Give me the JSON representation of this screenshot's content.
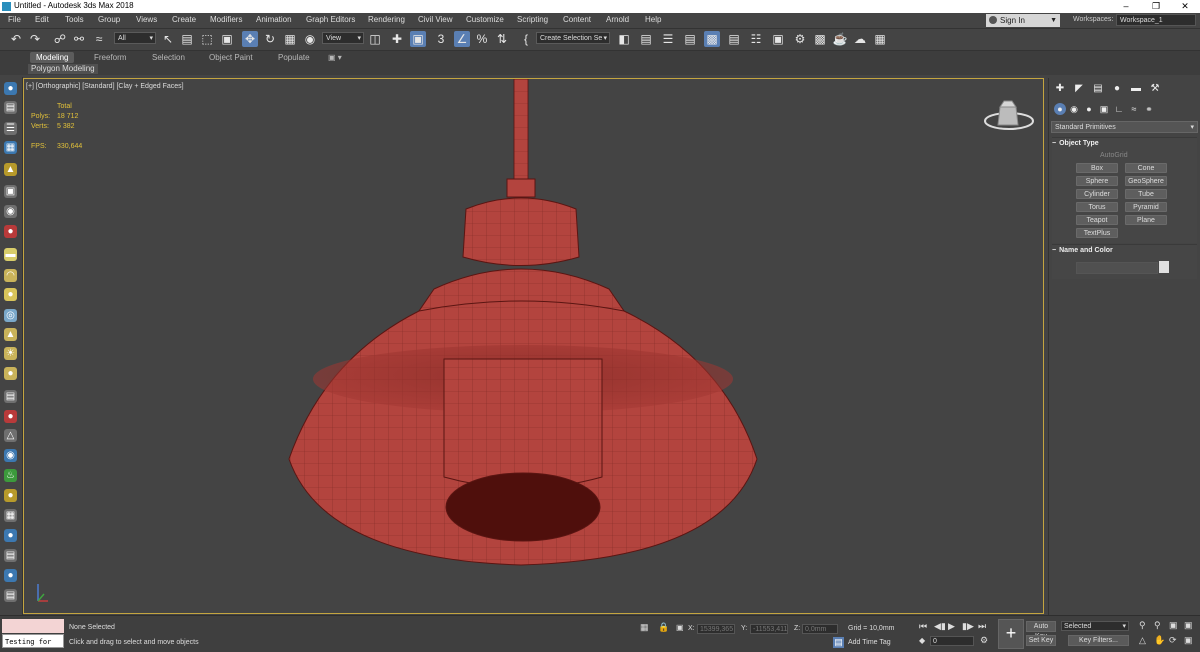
{
  "window": {
    "title": "Untitled - Autodesk 3ds Max 2018"
  },
  "menu": [
    "File",
    "Edit",
    "Tools",
    "Group",
    "Views",
    "Create",
    "Modifiers",
    "Animation",
    "Graph Editors",
    "Rendering",
    "Civil View",
    "Customize",
    "Scripting",
    "Content",
    "Arnold",
    "Help"
  ],
  "account": {
    "sign_in": "Sign In",
    "workspaces_label": "Workspaces:",
    "workspace": "Workspace_1"
  },
  "toolbar": {
    "filter": "All",
    "ref_coord": "View",
    "selection_set": "Create Selection Se"
  },
  "ribbon": {
    "tabs": [
      "Modeling",
      "Freeform",
      "Selection",
      "Object Paint",
      "Populate"
    ],
    "active_tab": "Modeling",
    "panel": "Polygon Modeling"
  },
  "viewport": {
    "label": "[+] [Orthographic] [Standard] [Clay + Edged Faces]",
    "stats": {
      "total_label": "Total",
      "polys_label": "Polys:",
      "polys": "18 712",
      "verts_label": "Verts:",
      "verts": "5 382",
      "fps_label": "FPS:",
      "fps": "330,644"
    },
    "model_color": "#b3443e"
  },
  "command_panel": {
    "category": "Standard Primitives",
    "object_type": {
      "title": "Object Type",
      "autogrid": "AutoGrid",
      "buttons": [
        "Box",
        "Cone",
        "Sphere",
        "GeoSphere",
        "Cylinder",
        "Tube",
        "Torus",
        "Pyramid",
        "Teapot",
        "Plane",
        "TextPlus"
      ]
    },
    "name_color": {
      "title": "Name and Color"
    }
  },
  "status": {
    "maxscript": "Testing for",
    "selection": "None Selected",
    "prompt": "Click and drag to select and move objects",
    "x_label": "X:",
    "x": "15399,365",
    "y_label": "Y:",
    "y": "-11553,411",
    "z_label": "Z:",
    "z": "0,0mm",
    "grid": "Grid = 10,0mm",
    "add_time_tag": "Add Time Tag",
    "frame": "0",
    "auto_key": "Auto Key",
    "set_key": "Set Key",
    "key_mode": "Selected",
    "key_filters": "Key Filters..."
  }
}
